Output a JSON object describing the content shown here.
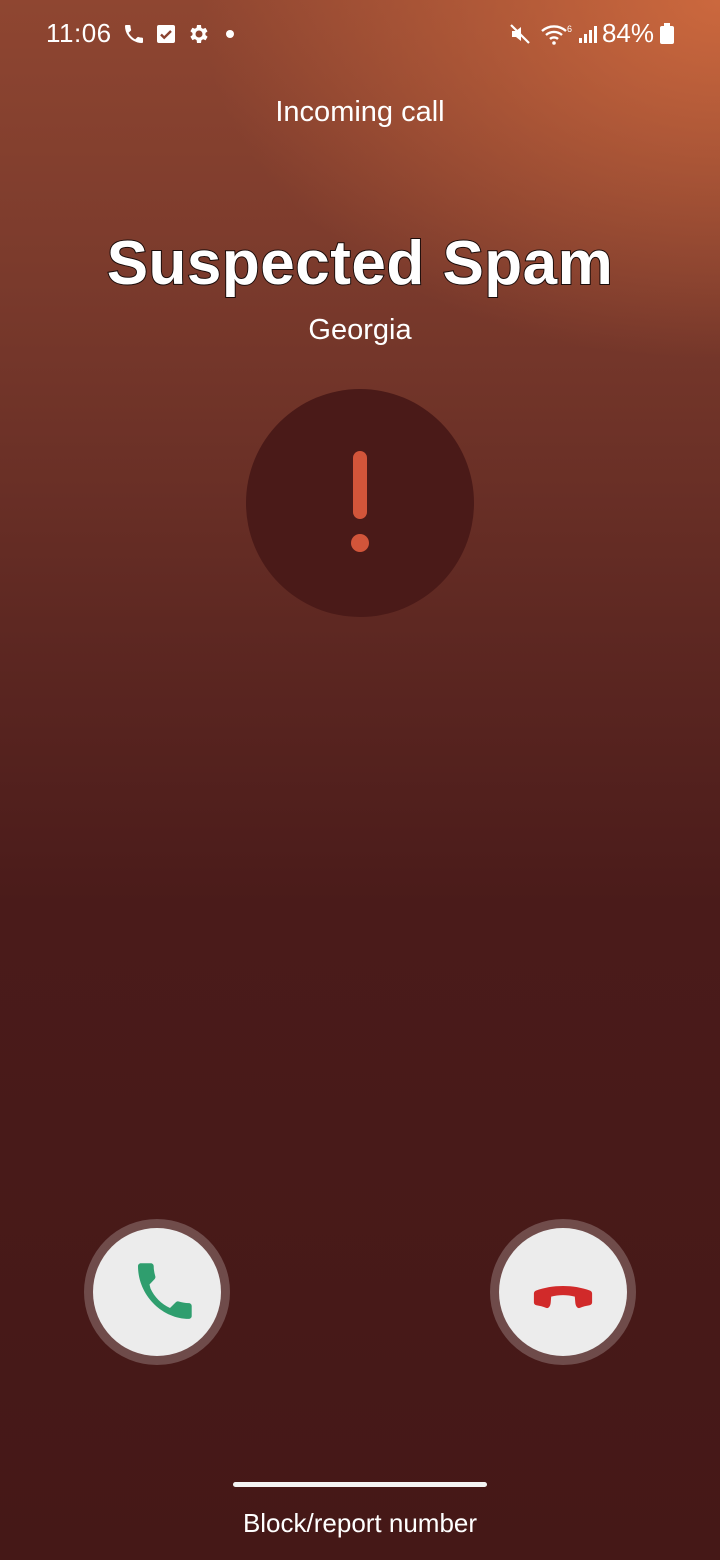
{
  "status_bar": {
    "time": "11:06",
    "left_icons": [
      "phone-icon",
      "checkbox-icon",
      "gear-icon",
      "dot-icon"
    ],
    "right_icons": [
      "mute-icon",
      "wifi-icon",
      "signal-icon"
    ],
    "battery_percent": "84%",
    "battery_level": 0.84
  },
  "call": {
    "status": "Incoming call",
    "caller_name": "Suspected Spam",
    "location": "Georgia",
    "warning_icon": "exclamation-icon"
  },
  "actions": {
    "answer_icon": "phone-answer-icon",
    "decline_icon": "phone-decline-icon",
    "block_report_label": "Block/report number"
  },
  "colors": {
    "warning_accent": "#d2553a",
    "answer_green": "#2f9e6e",
    "decline_red": "#d12a2a",
    "button_bg": "#ececec"
  }
}
